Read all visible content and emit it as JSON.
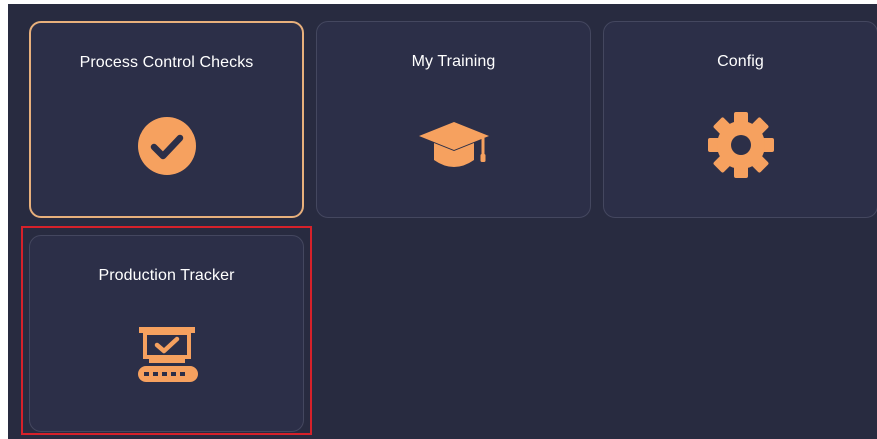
{
  "tiles": [
    {
      "label": "Process Control Checks",
      "icon": "check-circle-icon",
      "selected": true
    },
    {
      "label": "My Training",
      "icon": "graduation-cap-icon",
      "selected": false
    },
    {
      "label": "Config",
      "icon": "gear-icon",
      "selected": false
    },
    {
      "label": "Production Tracker",
      "icon": "conveyor-check-icon",
      "selected": false
    }
  ],
  "colors": {
    "background": "#282b40",
    "tile": "#2c2f48",
    "accent": "#f6a15f",
    "selected_border": "#e8b07c",
    "highlight": "#d6212a"
  }
}
